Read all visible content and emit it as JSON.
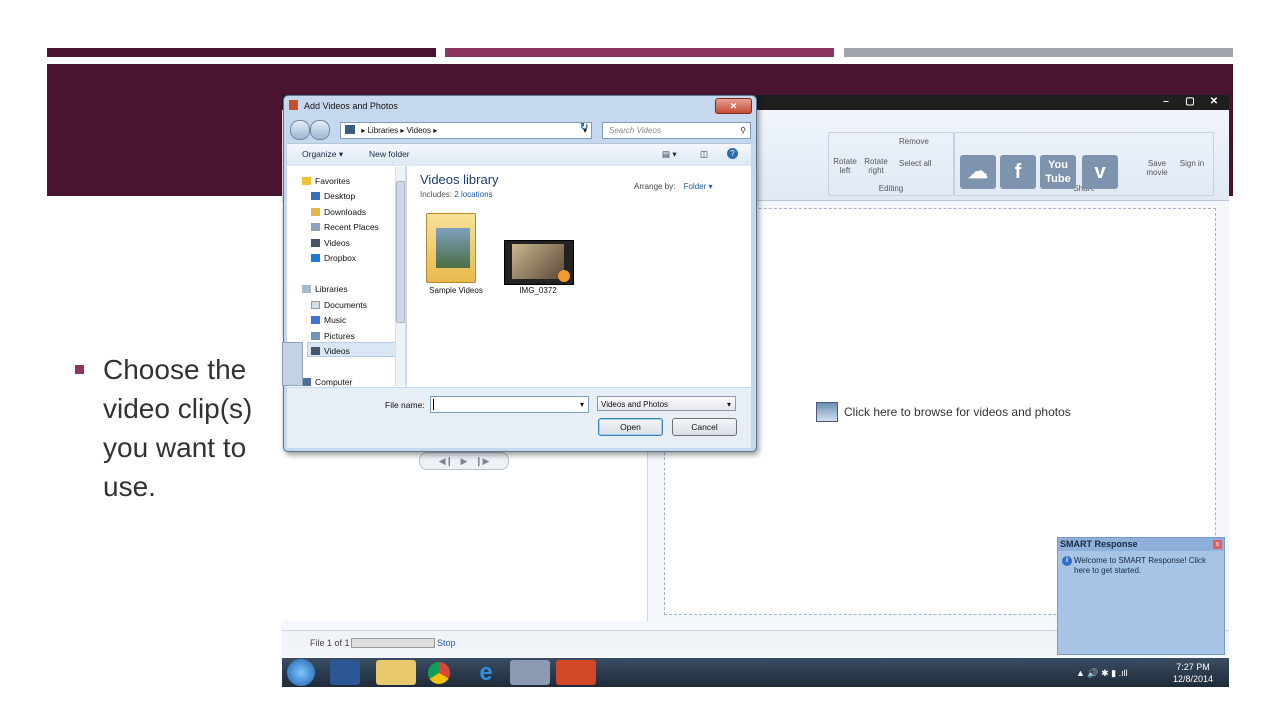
{
  "slide": {
    "bullet": "Choose the video clip(s) you want to use."
  },
  "movie_maker": {
    "window_buttons": [
      "–",
      "▢",
      "✕"
    ],
    "ribbon": {
      "editing_group": {
        "label": "Editing",
        "rotate_left": "Rotate left",
        "rotate_right": "Rotate right",
        "remove": "Remove",
        "select_all": "Select all"
      },
      "share_group": {
        "label": "Share",
        "save_movie": "Save movie",
        "sign_in": "Sign in"
      }
    },
    "browse_hint": "Click here to browse for videos and photos",
    "status": {
      "file_text": "File 1 of 1",
      "stop": "Stop"
    }
  },
  "dialog": {
    "title": "Add Videos and Photos",
    "close_label": "✕",
    "address": {
      "segments": [
        "Libraries",
        "Videos"
      ]
    },
    "search_placeholder": "Search Videos",
    "toolbar": {
      "organize": "Organize ▾",
      "new_folder": "New folder"
    },
    "nav": {
      "favorites_header": "Favorites",
      "favorites": [
        "Desktop",
        "Downloads",
        "Recent Places",
        "Videos",
        "Dropbox"
      ],
      "libraries_header": "Libraries",
      "libraries": [
        "Documents",
        "Music",
        "Pictures",
        "Videos"
      ],
      "computer": "Computer"
    },
    "library": {
      "title": "Videos library",
      "includes_label": "Includes:",
      "includes_link": "2 locations",
      "arrange_label": "Arrange by:",
      "arrange_value": "Folder ▾"
    },
    "items": [
      {
        "label": "Sample Videos"
      },
      {
        "label": "IMG_0372"
      }
    ],
    "file_name_label": "File name:",
    "file_name_value": "",
    "file_type": "Videos and Photos",
    "open_button": "Open",
    "cancel_button": "Cancel"
  },
  "smart_popup": {
    "title": "SMART Response",
    "message": "Welcome to SMART Response! Click here to get started."
  },
  "taskbar": {
    "time": "7:27 PM",
    "date": "12/8/2014"
  }
}
